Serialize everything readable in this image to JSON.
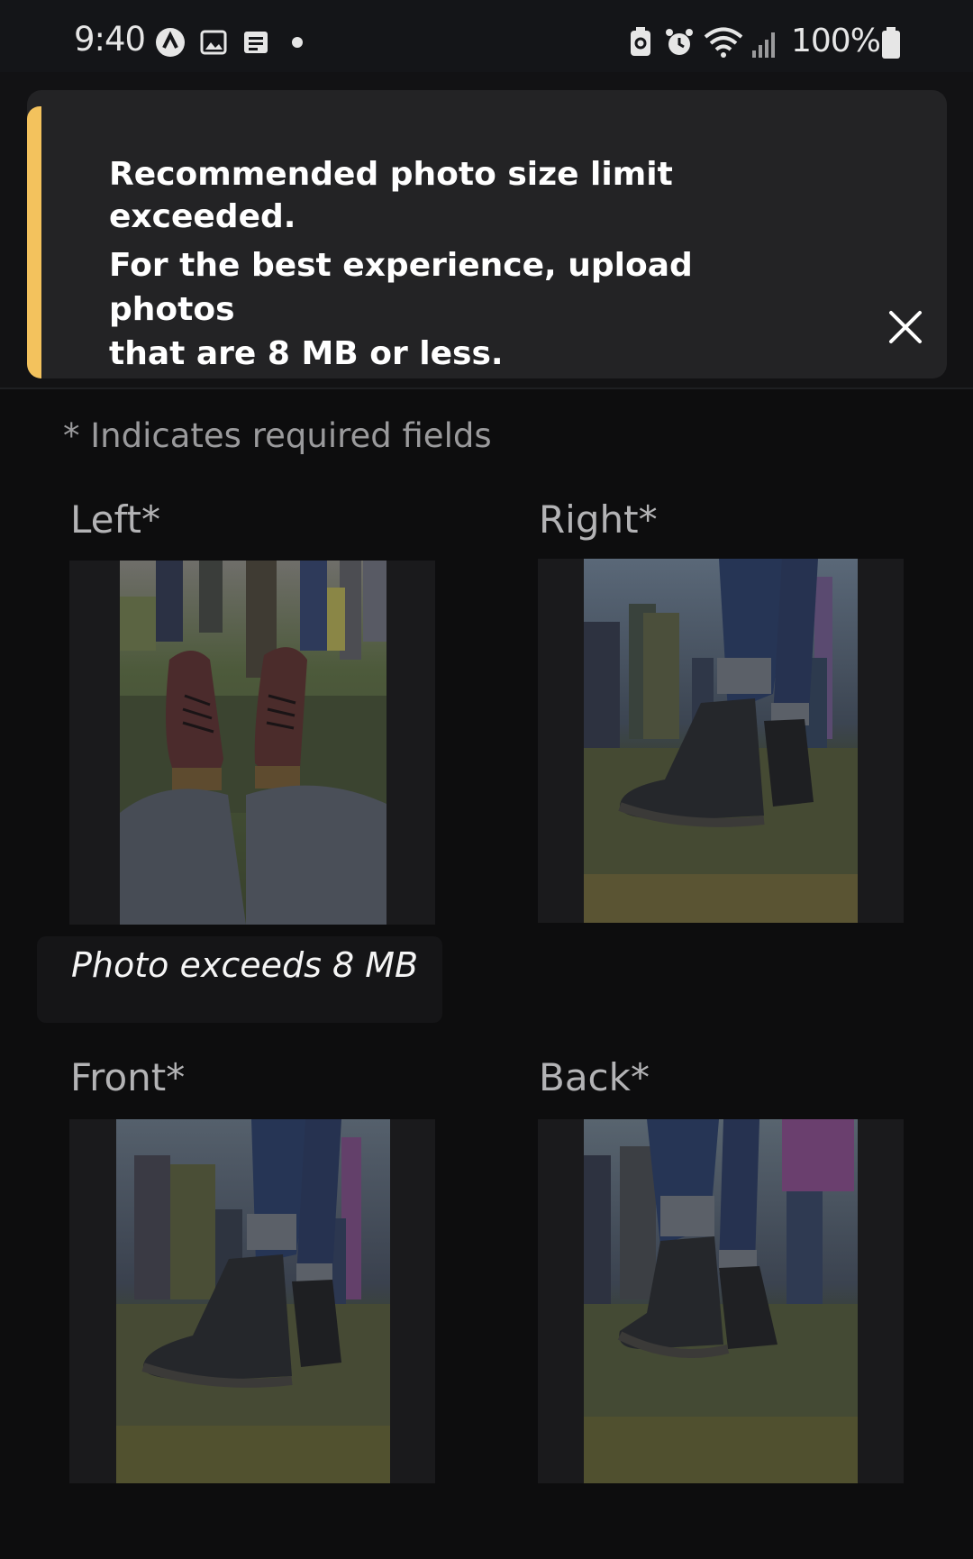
{
  "status_bar": {
    "time": "9:40",
    "battery_percent": "100%",
    "left_icons": [
      "navigation-icon",
      "gallery-icon",
      "message-icon",
      "dot-icon"
    ],
    "right_icons": [
      "battery-saver-icon",
      "alarm-icon",
      "wifi-icon",
      "signal-icon",
      "battery-icon"
    ]
  },
  "banner": {
    "accent_color": "#f3c25d",
    "title_line1": "Recommended photo size limit",
    "title_line2": "exceeded.",
    "body_line1": "For the best experience, upload photos",
    "body_line2": "that are 8 MB or less.",
    "close_icon": "close-icon"
  },
  "form": {
    "required_note": "* Indicates required fields",
    "fields": [
      {
        "label": "Left*",
        "error": "Photo exceeds 8 MB"
      },
      {
        "label": "Right*"
      },
      {
        "label": "Front*"
      },
      {
        "label": "Back*"
      }
    ]
  }
}
